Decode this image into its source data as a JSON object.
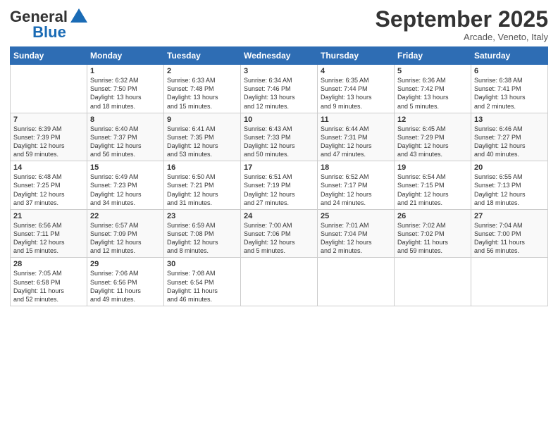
{
  "header": {
    "logo_general": "General",
    "logo_blue": "Blue",
    "month_title": "September 2025",
    "location": "Arcade, Veneto, Italy"
  },
  "days_of_week": [
    "Sunday",
    "Monday",
    "Tuesday",
    "Wednesday",
    "Thursday",
    "Friday",
    "Saturday"
  ],
  "weeks": [
    [
      {
        "num": "",
        "info": ""
      },
      {
        "num": "1",
        "info": "Sunrise: 6:32 AM\nSunset: 7:50 PM\nDaylight: 13 hours\nand 18 minutes."
      },
      {
        "num": "2",
        "info": "Sunrise: 6:33 AM\nSunset: 7:48 PM\nDaylight: 13 hours\nand 15 minutes."
      },
      {
        "num": "3",
        "info": "Sunrise: 6:34 AM\nSunset: 7:46 PM\nDaylight: 13 hours\nand 12 minutes."
      },
      {
        "num": "4",
        "info": "Sunrise: 6:35 AM\nSunset: 7:44 PM\nDaylight: 13 hours\nand 9 minutes."
      },
      {
        "num": "5",
        "info": "Sunrise: 6:36 AM\nSunset: 7:42 PM\nDaylight: 13 hours\nand 5 minutes."
      },
      {
        "num": "6",
        "info": "Sunrise: 6:38 AM\nSunset: 7:41 PM\nDaylight: 13 hours\nand 2 minutes."
      }
    ],
    [
      {
        "num": "7",
        "info": "Sunrise: 6:39 AM\nSunset: 7:39 PM\nDaylight: 12 hours\nand 59 minutes."
      },
      {
        "num": "8",
        "info": "Sunrise: 6:40 AM\nSunset: 7:37 PM\nDaylight: 12 hours\nand 56 minutes."
      },
      {
        "num": "9",
        "info": "Sunrise: 6:41 AM\nSunset: 7:35 PM\nDaylight: 12 hours\nand 53 minutes."
      },
      {
        "num": "10",
        "info": "Sunrise: 6:43 AM\nSunset: 7:33 PM\nDaylight: 12 hours\nand 50 minutes."
      },
      {
        "num": "11",
        "info": "Sunrise: 6:44 AM\nSunset: 7:31 PM\nDaylight: 12 hours\nand 47 minutes."
      },
      {
        "num": "12",
        "info": "Sunrise: 6:45 AM\nSunset: 7:29 PM\nDaylight: 12 hours\nand 43 minutes."
      },
      {
        "num": "13",
        "info": "Sunrise: 6:46 AM\nSunset: 7:27 PM\nDaylight: 12 hours\nand 40 minutes."
      }
    ],
    [
      {
        "num": "14",
        "info": "Sunrise: 6:48 AM\nSunset: 7:25 PM\nDaylight: 12 hours\nand 37 minutes."
      },
      {
        "num": "15",
        "info": "Sunrise: 6:49 AM\nSunset: 7:23 PM\nDaylight: 12 hours\nand 34 minutes."
      },
      {
        "num": "16",
        "info": "Sunrise: 6:50 AM\nSunset: 7:21 PM\nDaylight: 12 hours\nand 31 minutes."
      },
      {
        "num": "17",
        "info": "Sunrise: 6:51 AM\nSunset: 7:19 PM\nDaylight: 12 hours\nand 27 minutes."
      },
      {
        "num": "18",
        "info": "Sunrise: 6:52 AM\nSunset: 7:17 PM\nDaylight: 12 hours\nand 24 minutes."
      },
      {
        "num": "19",
        "info": "Sunrise: 6:54 AM\nSunset: 7:15 PM\nDaylight: 12 hours\nand 21 minutes."
      },
      {
        "num": "20",
        "info": "Sunrise: 6:55 AM\nSunset: 7:13 PM\nDaylight: 12 hours\nand 18 minutes."
      }
    ],
    [
      {
        "num": "21",
        "info": "Sunrise: 6:56 AM\nSunset: 7:11 PM\nDaylight: 12 hours\nand 15 minutes."
      },
      {
        "num": "22",
        "info": "Sunrise: 6:57 AM\nSunset: 7:09 PM\nDaylight: 12 hours\nand 12 minutes."
      },
      {
        "num": "23",
        "info": "Sunrise: 6:59 AM\nSunset: 7:08 PM\nDaylight: 12 hours\nand 8 minutes."
      },
      {
        "num": "24",
        "info": "Sunrise: 7:00 AM\nSunset: 7:06 PM\nDaylight: 12 hours\nand 5 minutes."
      },
      {
        "num": "25",
        "info": "Sunrise: 7:01 AM\nSunset: 7:04 PM\nDaylight: 12 hours\nand 2 minutes."
      },
      {
        "num": "26",
        "info": "Sunrise: 7:02 AM\nSunset: 7:02 PM\nDaylight: 11 hours\nand 59 minutes."
      },
      {
        "num": "27",
        "info": "Sunrise: 7:04 AM\nSunset: 7:00 PM\nDaylight: 11 hours\nand 56 minutes."
      }
    ],
    [
      {
        "num": "28",
        "info": "Sunrise: 7:05 AM\nSunset: 6:58 PM\nDaylight: 11 hours\nand 52 minutes."
      },
      {
        "num": "29",
        "info": "Sunrise: 7:06 AM\nSunset: 6:56 PM\nDaylight: 11 hours\nand 49 minutes."
      },
      {
        "num": "30",
        "info": "Sunrise: 7:08 AM\nSunset: 6:54 PM\nDaylight: 11 hours\nand 46 minutes."
      },
      {
        "num": "",
        "info": ""
      },
      {
        "num": "",
        "info": ""
      },
      {
        "num": "",
        "info": ""
      },
      {
        "num": "",
        "info": ""
      }
    ]
  ]
}
